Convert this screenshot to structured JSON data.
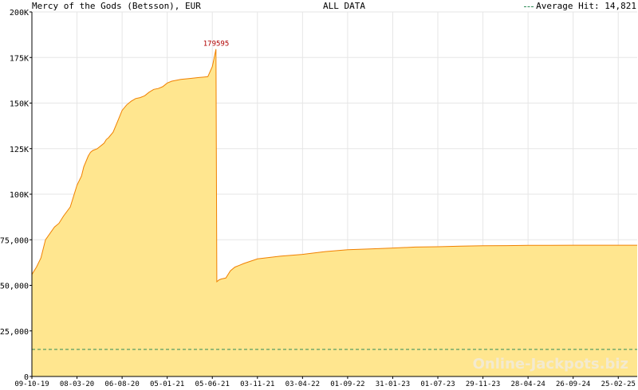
{
  "header": {
    "title": "Mercy of the Gods (Betsson), EUR",
    "subtitle": "ALL DATA",
    "legend_label": "Average Hit: 14,821"
  },
  "watermark": "Online-Jackpots.biz",
  "chart_data": {
    "type": "area",
    "title": "Mercy of the Gods (Betsson), EUR",
    "subtitle": "ALL DATA",
    "xlabel": "",
    "ylabel": "",
    "ylim": [
      0,
      200000
    ],
    "yticks": [
      0,
      25000,
      50000,
      75000,
      100000,
      125000,
      150000,
      175000,
      200000
    ],
    "ytick_labels": [
      "0",
      "25,000",
      "50,000",
      "75,000",
      "100K",
      "125K",
      "150K",
      "175K",
      "200K"
    ],
    "xticks": [
      "09-10-19",
      "08-03-20",
      "06-08-20",
      "05-01-21",
      "05-06-21",
      "03-11-21",
      "03-04-22",
      "01-09-22",
      "31-01-23",
      "01-07-23",
      "29-11-23",
      "28-04-24",
      "26-09-24",
      "25-02-25"
    ],
    "grid": true,
    "fill_color": "#ffe68f",
    "line_color": "#f08000",
    "average_hit": 14821,
    "average_color": "#2e8b57",
    "peak": {
      "x": 4.08,
      "value": 179595,
      "label": "179595"
    },
    "series": [
      {
        "x": [
          0,
          0.1,
          0.2,
          0.3,
          0.5,
          0.6,
          0.7,
          0.85,
          1.0,
          1.1,
          1.15,
          1.25,
          1.3,
          1.35,
          1.45,
          1.5,
          1.55,
          1.6,
          1.65,
          1.7,
          1.8,
          1.9,
          2.0,
          2.1,
          2.2,
          2.3,
          2.4,
          2.5,
          2.6,
          2.7,
          2.8,
          2.9,
          3.0,
          3.1,
          3.2,
          3.3,
          3.5,
          3.7,
          3.9,
          4.0,
          4.05,
          4.08,
          4.1,
          4.15,
          4.2,
          4.3,
          4.4,
          4.5,
          4.6,
          4.7,
          5.0,
          5.5,
          6.0,
          6.5,
          7.0,
          7.5,
          8.0,
          8.5,
          9.0,
          9.5,
          10.0,
          10.5,
          11.0,
          11.5,
          12.0,
          12.5,
          13.0,
          13.42
        ],
        "values": [
          56000,
          60000,
          65000,
          75000,
          82000,
          84000,
          88000,
          93000,
          105000,
          110000,
          115000,
          121000,
          123000,
          124000,
          125000,
          126000,
          127000,
          128000,
          130000,
          131000,
          134000,
          140000,
          146000,
          149000,
          151000,
          152500,
          153000,
          154000,
          156000,
          157500,
          158000,
          159000,
          161000,
          162000,
          162500,
          163000,
          163500,
          164000,
          164500,
          170000,
          176000,
          179595,
          52000,
          53000,
          53500,
          54000,
          58000,
          60000,
          61000,
          62000,
          64500,
          66000,
          67000,
          68500,
          69500,
          70000,
          70500,
          71000,
          71200,
          71500,
          71700,
          71800,
          71900,
          71950,
          72000,
          72000,
          72000,
          72000
        ]
      }
    ]
  }
}
